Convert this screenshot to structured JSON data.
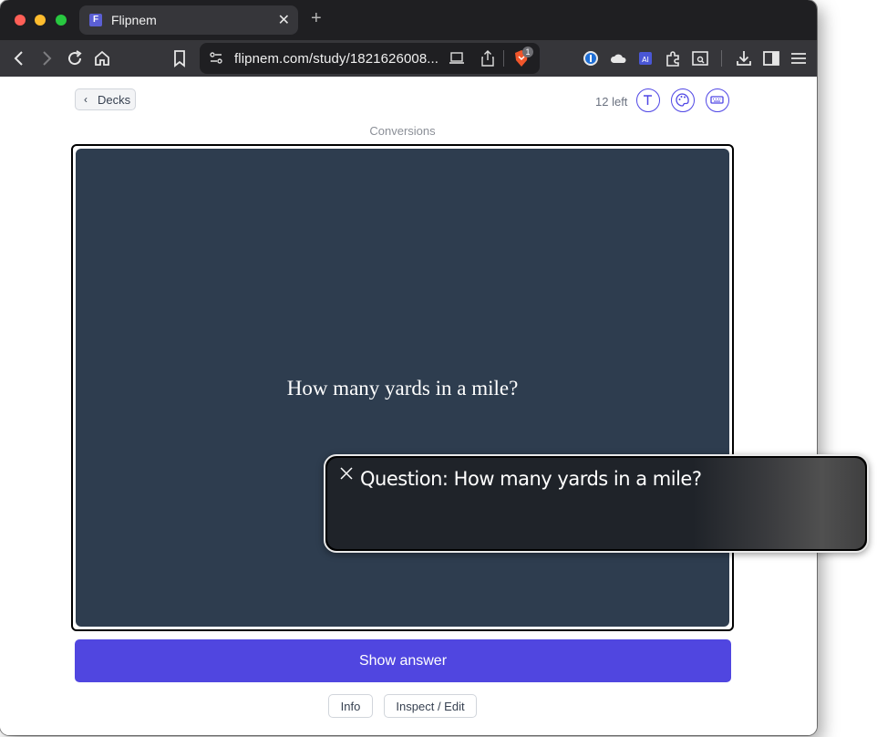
{
  "browser": {
    "tab_title": "Flipnem",
    "favicon_letter": "F",
    "new_tab": "+",
    "close_tab": "✕",
    "url": "flipnem.com/study/1821626008...",
    "brave_badge": "1"
  },
  "page": {
    "back_label": "Decks",
    "remaining": "12 left",
    "deck_name": "Conversions",
    "card_question": "How many yards in a mile?",
    "show_answer": "Show answer",
    "info": "Info",
    "inspect_edit": "Inspect / Edit"
  },
  "overlay": {
    "caption": "Question: How many yards in a mile?"
  },
  "colors": {
    "card_background": "#2e3d4f",
    "accent": "#5046e0",
    "icon_outline": "#4f46e5"
  }
}
